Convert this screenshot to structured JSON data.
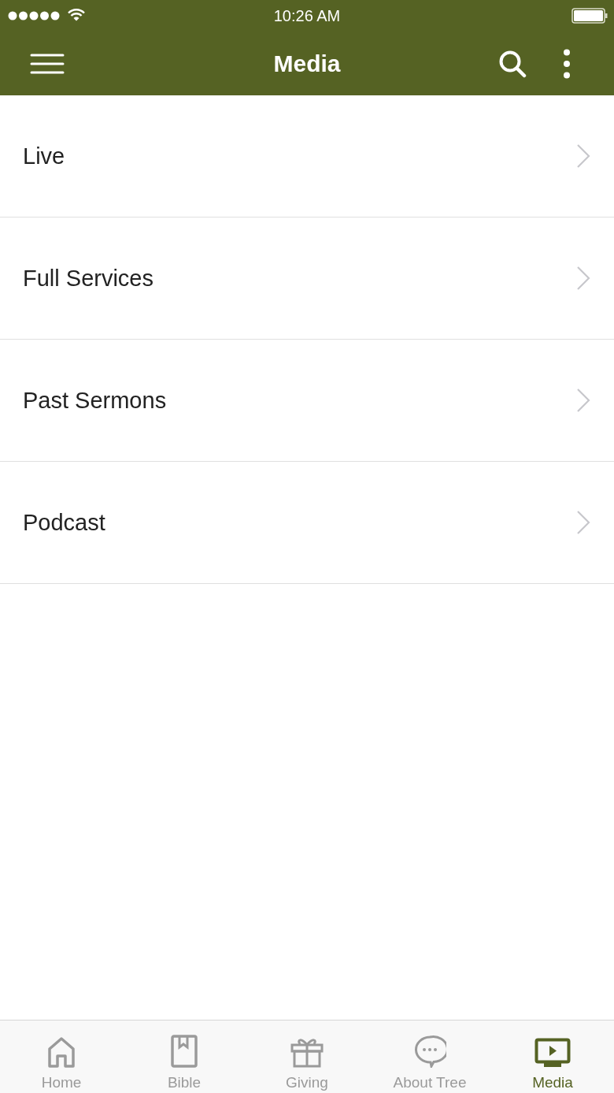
{
  "status_bar": {
    "time": "10:26 AM"
  },
  "nav_bar": {
    "title": "Media"
  },
  "menu_items": [
    {
      "label": "Live"
    },
    {
      "label": "Full Services"
    },
    {
      "label": "Past Sermons"
    },
    {
      "label": "Podcast"
    }
  ],
  "tab_bar": [
    {
      "kind": "home",
      "label": "Home",
      "selected": false
    },
    {
      "kind": "bible",
      "label": "Bible",
      "selected": false
    },
    {
      "kind": "giving",
      "label": "Giving",
      "selected": false
    },
    {
      "kind": "chat",
      "label": "About Tree",
      "selected": false
    },
    {
      "kind": "media",
      "label": "Media",
      "selected": true
    }
  ]
}
